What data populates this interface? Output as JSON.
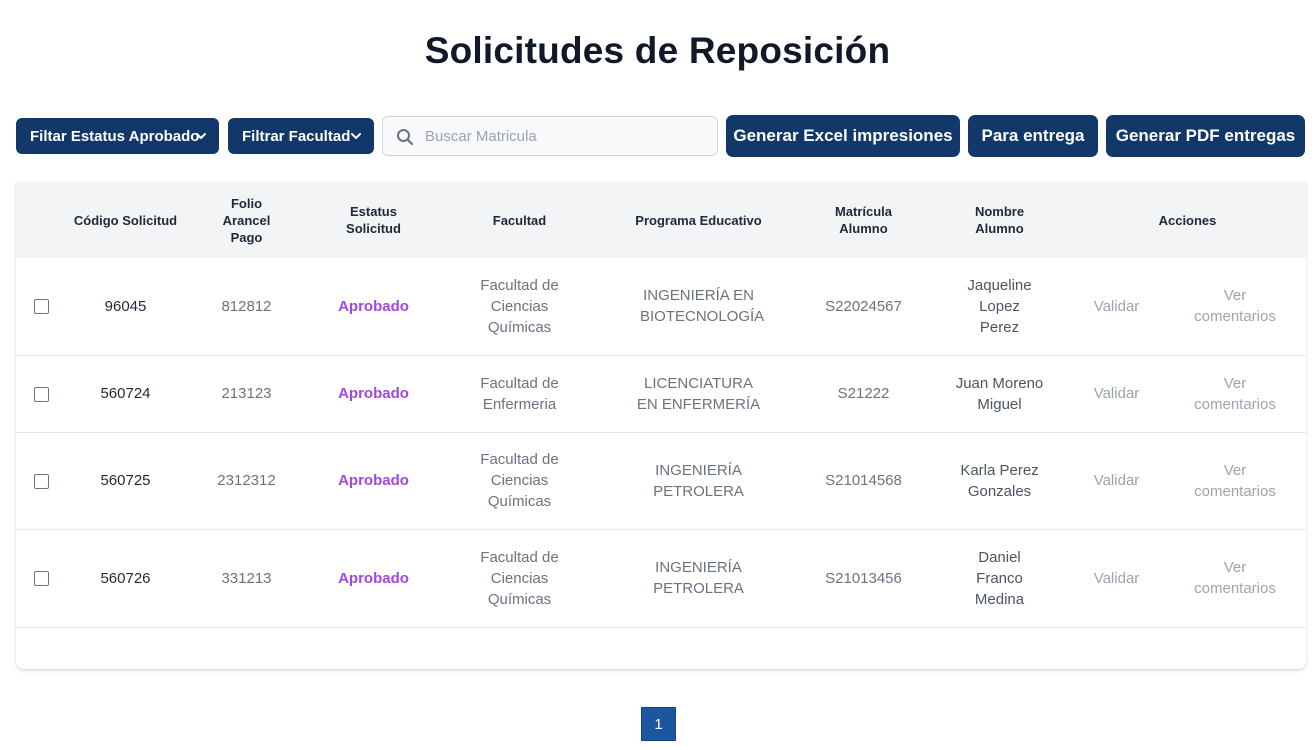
{
  "page": {
    "title": "Solicitudes de Reposición"
  },
  "toolbar": {
    "status_filter_label": "Filtar Estatus Aprobado",
    "faculty_filter_label": "Filtrar Facultad",
    "search_placeholder": "Buscar Matricula",
    "search_value": "",
    "excel_button_label": "Generar Excel impresiones",
    "delivery_button_label": "Para entrega",
    "pdf_button_label": "Generar PDF entregas"
  },
  "table": {
    "headers": {
      "code": "Código Solicitud",
      "folio": "Folio Arancel Pago",
      "status": "Estatus Solicitud",
      "faculty": "Facultad",
      "program": "Programa Educativo",
      "matricula": "Matrícula Alumno",
      "name": "Nombre Alumno",
      "actions": "Acciones"
    },
    "rows": [
      {
        "code": "96045",
        "folio": "812812",
        "status": "Aprobado",
        "faculty": "Facultad de Ciencias Químicas",
        "program": "INGENIERÍA EN BIOTECNOLOGÍA",
        "matricula": "S22024567",
        "name": "Jaqueline Lopez Perez",
        "validate": "Validar",
        "comments": "Ver comentarios"
      },
      {
        "code": "560724",
        "folio": "213123",
        "status": "Aprobado",
        "faculty": "Facultad de Enfermeria",
        "program": "LICENCIATURA EN ENFERMERÍA",
        "matricula": "S21222",
        "name": "Juan Moreno Miguel",
        "validate": "Validar",
        "comments": "Ver comentarios"
      },
      {
        "code": "560725",
        "folio": "2312312",
        "status": "Aprobado",
        "faculty": "Facultad de Ciencias Químicas",
        "program": "INGENIERÍA PETROLERA",
        "matricula": "S21014568",
        "name": "Karla Perez Gonzales",
        "validate": "Validar",
        "comments": "Ver comentarios"
      },
      {
        "code": "560726",
        "folio": "331213",
        "status": "Aprobado",
        "faculty": "Facultad de Ciencias Químicas",
        "program": "INGENIERÍA PETROLERA",
        "matricula": "S21013456",
        "name": "Daniel Franco Medina",
        "validate": "Validar",
        "comments": "Ver comentarios"
      }
    ]
  },
  "pagination": {
    "current_page": "1"
  },
  "colors": {
    "primary": "#12386a",
    "status_approved": "#a347e0",
    "pager_active": "#1d56a0",
    "header_bg": "#f3f4f6"
  },
  "icons": {
    "dropdown": "chevron-down-icon",
    "search": "search-icon",
    "checkbox": "checkbox-icon"
  }
}
